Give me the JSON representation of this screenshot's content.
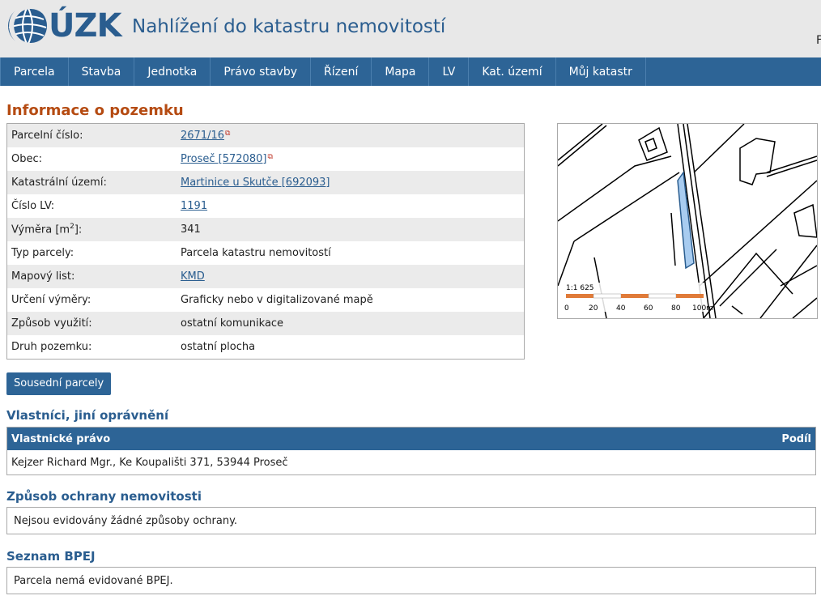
{
  "header": {
    "logo_text": "ÚZK",
    "app_title": "Nahlížení do katastru nemovitostí",
    "corner_text": "F"
  },
  "nav": {
    "items": [
      "Parcela",
      "Stavba",
      "Jednotka",
      "Právo stavby",
      "Řízení",
      "Mapa",
      "LV",
      "Kat. území",
      "Můj katastr"
    ]
  },
  "parcel": {
    "title": "Informace o pozemku",
    "rows": [
      {
        "label": "Parcelní číslo:",
        "value": "2671/16"
      },
      {
        "label": "Obec:",
        "value": "Proseč [572080]"
      },
      {
        "label": "Katastrální území:",
        "value": "Martinice u Skutče [692093]"
      },
      {
        "label": "Číslo LV:",
        "value": "1191"
      },
      {
        "label": "Výměra [m2]:",
        "value": "341"
      },
      {
        "label": "Typ parcely:",
        "value": "Parcela katastru nemovitostí"
      },
      {
        "label": "Mapový list:",
        "value": "KMD"
      },
      {
        "label": "Určení výměry:",
        "value": "Graficky nebo v digitalizované mapě"
      },
      {
        "label": "Způsob využití:",
        "value": "ostatní komunikace"
      },
      {
        "label": "Druh pozemku:",
        "value": "ostatní plocha"
      }
    ]
  },
  "map": {
    "scale_label": "1:1 625",
    "scale_ticks": [
      "0",
      "20",
      "40",
      "60",
      "80",
      "100m"
    ]
  },
  "neighbours_button": "Sousední parcely",
  "owners": {
    "title": "Vlastníci, jiní oprávnění",
    "col_right": "Vlastnické právo",
    "col_share": "Podíl",
    "row": "Kejzer Richard Mgr., Ke Koupališti 371, 53944 Proseč"
  },
  "protection": {
    "title": "Způsob ochrany nemovitosti",
    "text": "Nejsou evidovány žádné způsoby ochrany."
  },
  "bpej": {
    "title": "Seznam BPEJ",
    "text": "Parcela nemá evidované BPEJ."
  },
  "colors": {
    "brand_blue": "#2d6496",
    "title_orange": "#b54b12",
    "parcel_highlight": "#a8ccf0"
  }
}
